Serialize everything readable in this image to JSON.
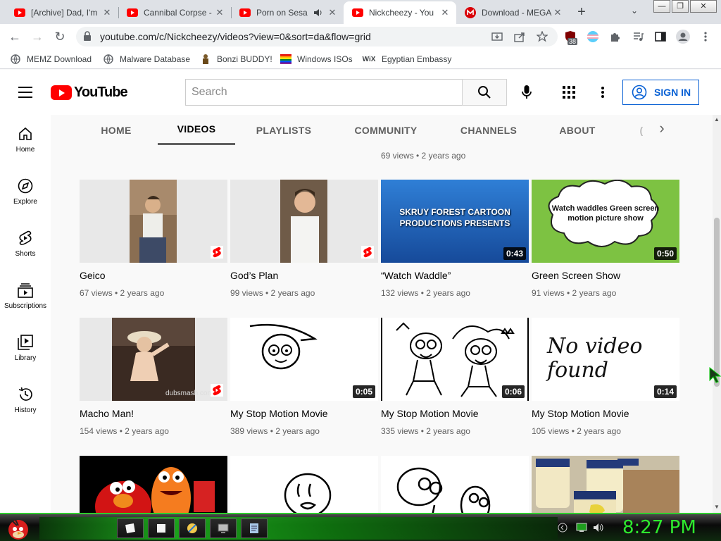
{
  "browser": {
    "tabs": [
      {
        "title": "[Archive] Dad, I'm",
        "icon": "youtube-icon",
        "active": false
      },
      {
        "title": "Cannibal Corpse -",
        "icon": "youtube-icon",
        "active": false
      },
      {
        "title": "Porn on Sesa",
        "icon": "youtube-icon",
        "active": false,
        "audio": true
      },
      {
        "title": "Nickcheezy - You",
        "icon": "youtube-icon",
        "active": true
      },
      {
        "title": "Download - MEGA",
        "icon": "mega-icon",
        "active": false
      }
    ],
    "close_glyph": "✕",
    "new_tab_glyph": "+",
    "tab_menu_glyph": "⌄",
    "window_buttons": [
      "—",
      "❐",
      "✕"
    ],
    "url": "youtube.com/c/Nickcheezy/videos?view=0&sort=da&flow=grid",
    "extension_badge": "38",
    "bookmarks": [
      {
        "label": "MEMZ Download",
        "icon": "globe-icon"
      },
      {
        "label": "Malware Database",
        "icon": "globe-icon"
      },
      {
        "label": "Bonzi BUDDY!",
        "icon": "bonzi-icon"
      },
      {
        "label": "Windows ISOs",
        "icon": "windows-icon"
      },
      {
        "label": "Egyptian Embassy",
        "icon": "wix-icon",
        "glyph": "WiX"
      }
    ]
  },
  "youtube": {
    "logo_text": "YouTube",
    "search_placeholder": "Search",
    "sign_in": "SIGN IN",
    "sidebar": [
      {
        "label": "Home",
        "icon": "home-icon"
      },
      {
        "label": "Explore",
        "icon": "compass-icon"
      },
      {
        "label": "Shorts",
        "icon": "shorts-icon"
      },
      {
        "label": "Subscriptions",
        "icon": "subscriptions-icon"
      },
      {
        "label": "Library",
        "icon": "library-icon"
      },
      {
        "label": "History",
        "icon": "history-icon"
      }
    ],
    "channel_tabs": [
      {
        "label": "HOME",
        "active": false
      },
      {
        "label": "VIDEOS",
        "active": true
      },
      {
        "label": "PLAYLISTS",
        "active": false
      },
      {
        "label": "COMMUNITY",
        "active": false
      },
      {
        "label": "CHANNELS",
        "active": false
      },
      {
        "label": "ABOUT",
        "active": false
      }
    ],
    "partial_row_meta": "69 views • 2 years ago",
    "videos": [
      {
        "title": "Geico",
        "meta": "67 views • 2 years ago",
        "duration": "",
        "shorts": true
      },
      {
        "title": "God’s Plan",
        "meta": "99 views • 2 years ago",
        "duration": "",
        "shorts": true
      },
      {
        "title": "“Watch Waddle”",
        "meta": "132 views • 2 years ago",
        "duration": "0:43",
        "shorts": false,
        "thumb_text": "SKRUY FOREST CARTOON PRODUCTIONS PRESENTS"
      },
      {
        "title": "Green Screen Show",
        "meta": "91 views • 2 years ago",
        "duration": "0:50",
        "shorts": false,
        "thumb_text": "Watch waddles Green screen motion picture show"
      },
      {
        "title": "Macho Man!",
        "meta": "154 views • 2 years ago",
        "duration": "",
        "shorts": true,
        "thumb_text": "dubsmash.com"
      },
      {
        "title": "My Stop Motion Movie",
        "meta": "389 views • 2 years ago",
        "duration": "0:05",
        "shorts": false
      },
      {
        "title": "My Stop Motion Movie",
        "meta": "335 views • 2 years ago",
        "duration": "0:06",
        "shorts": false
      },
      {
        "title": "My Stop Motion Movie",
        "meta": "105 views • 2 years ago",
        "duration": "0:14",
        "shorts": false,
        "thumb_text": "No video found"
      }
    ]
  },
  "taskbar": {
    "clock": "8:27 PM"
  }
}
